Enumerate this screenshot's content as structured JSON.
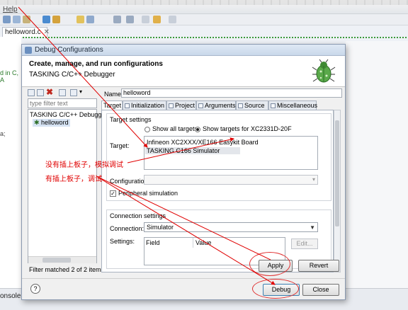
{
  "ide": {
    "help_menu": "Help",
    "editor_tab": "helloword.c",
    "console_tab": "onsole",
    "bg_code_1": "d in C, A",
    "bg_code_2": "a;"
  },
  "dialog": {
    "title": "Debug Configurations",
    "header_title": "Create, manage, and run configurations",
    "header_subtitle": "TASKING C/C++ Debugger",
    "filter_placeholder": "type filter text",
    "tree": [
      "TASKING C/C++ Debugger",
      "helloword"
    ],
    "filter_status": "Filter matched 2 of 2 items",
    "name_label": "Name:",
    "name_value": "helloword",
    "tabs": [
      "Target",
      "Initialization",
      "Project",
      "Arguments",
      "Source",
      "Miscellaneous"
    ],
    "target_settings": {
      "title": "Target settings",
      "show_all": "Show all targets",
      "show_for": "Show targets for XC2331D-20F",
      "target_label": "Target:",
      "targets": [
        "Infineon XC2XXX/XE166 Easykit Board",
        "TASKING C166 Simulator"
      ],
      "configuration_label": "Configuration:",
      "peripheral_label": "Peripheral simulation",
      "peripheral_checked": true
    },
    "connection_settings": {
      "title": "Connection settings",
      "connection_label": "Connection:",
      "connection_value": "Simulator",
      "settings_label": "Settings:",
      "columns": [
        "Field",
        "Value"
      ],
      "edit_button": "Edit..."
    },
    "buttons": {
      "apply": "Apply",
      "revert": "Revert",
      "debug": "Debug",
      "close": "Close",
      "help": "?"
    }
  },
  "annotations": {
    "line1": "没有插上板子，模拟调试",
    "line2": "有插上板子，调试",
    "color": "#e00000"
  }
}
